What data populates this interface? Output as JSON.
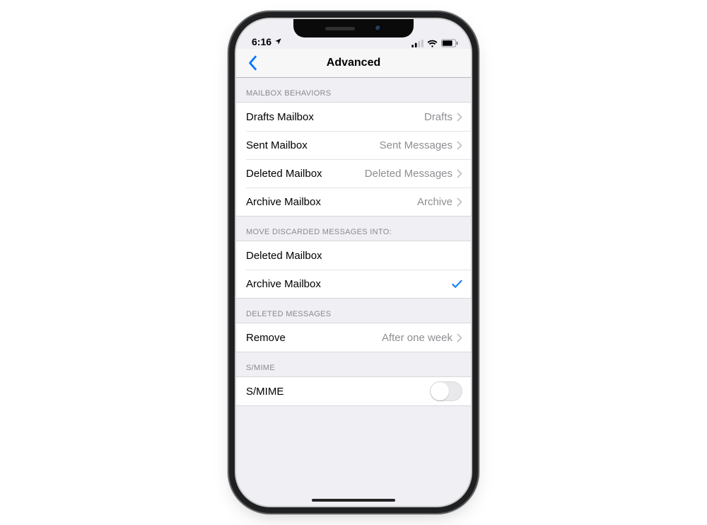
{
  "status": {
    "time": "6:16",
    "location_icon": "location-arrow"
  },
  "nav": {
    "title": "Advanced"
  },
  "sections": {
    "mailbox_behaviors": {
      "header": "MAILBOX BEHAVIORS",
      "rows": [
        {
          "label": "Drafts Mailbox",
          "value": "Drafts"
        },
        {
          "label": "Sent Mailbox",
          "value": "Sent Messages"
        },
        {
          "label": "Deleted Mailbox",
          "value": "Deleted Messages"
        },
        {
          "label": "Archive Mailbox",
          "value": "Archive"
        }
      ]
    },
    "move_discarded": {
      "header": "MOVE DISCARDED MESSAGES INTO:",
      "rows": [
        {
          "label": "Deleted Mailbox",
          "selected": false
        },
        {
          "label": "Archive Mailbox",
          "selected": true
        }
      ]
    },
    "deleted_messages": {
      "header": "DELETED MESSAGES",
      "rows": [
        {
          "label": "Remove",
          "value": "After one week"
        }
      ]
    },
    "smime": {
      "header": "S/MIME",
      "rows": [
        {
          "label": "S/MIME",
          "toggle": false
        }
      ]
    }
  }
}
